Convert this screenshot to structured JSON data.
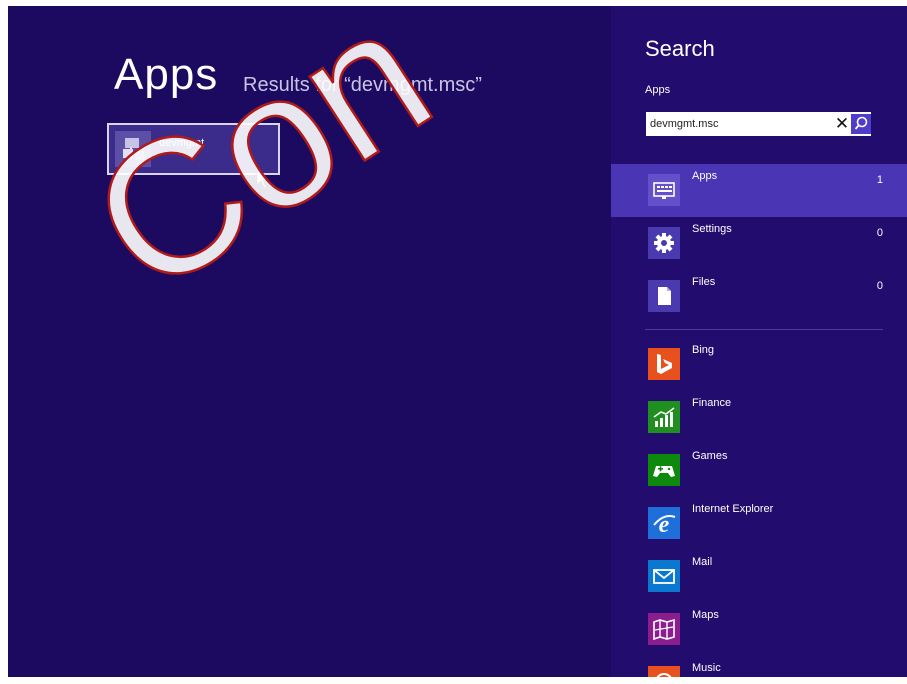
{
  "results": {
    "title": "Apps",
    "subtitle": "Results for “devmgmt.msc”",
    "items": [
      {
        "label": "devmgmt",
        "icon": "device-manager-icon"
      }
    ]
  },
  "search": {
    "title": "Search",
    "scope_label": "Apps",
    "query": "devmgmt.msc",
    "clear_icon": "close-icon",
    "submit_icon": "search-icon"
  },
  "scopes": [
    {
      "label": "Apps",
      "count": "1",
      "icon": "apps-icon",
      "selected": true
    },
    {
      "label": "Settings",
      "count": "0",
      "icon": "gear-icon",
      "selected": false
    },
    {
      "label": "Files",
      "count": "0",
      "icon": "file-icon",
      "selected": false
    }
  ],
  "apps": [
    {
      "label": "Bing",
      "icon": "bing-icon",
      "color": "#e8501e"
    },
    {
      "label": "Finance",
      "icon": "finance-icon",
      "color": "#1f8f1f"
    },
    {
      "label": "Games",
      "icon": "games-icon",
      "color": "#0d8a0d"
    },
    {
      "label": "Internet Explorer",
      "icon": "internet-explorer-icon",
      "color": "#1e6fd9"
    },
    {
      "label": "Mail",
      "icon": "mail-icon",
      "color": "#0a78cf"
    },
    {
      "label": "Maps",
      "icon": "maps-icon",
      "color": "#8b1d8f"
    },
    {
      "label": "Music",
      "icon": "music-icon",
      "color": "#e8501e"
    }
  ],
  "watermark": {
    "text": "Con"
  },
  "colors": {
    "background": "#1b0a5f",
    "charm_background": "#220d6e",
    "selected_scope": "#4a35b5",
    "accent": "#4f3cc9"
  }
}
